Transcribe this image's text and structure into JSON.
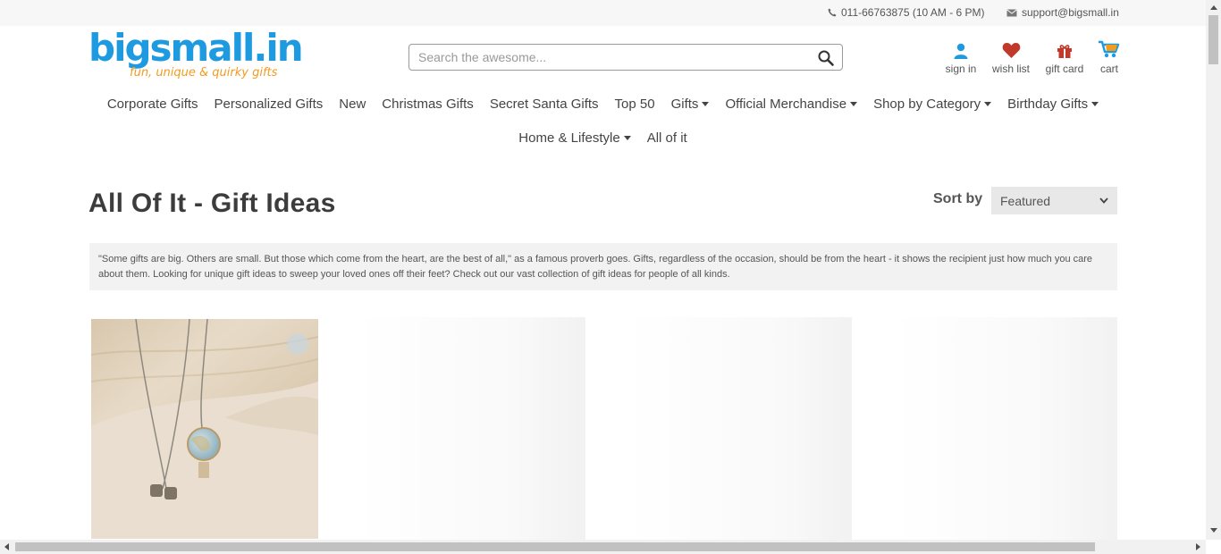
{
  "topbar": {
    "phone": "011-66763875 (10 AM - 6 PM)",
    "email": "support@bigsmall.in"
  },
  "logo": {
    "name": "bigsmall.in",
    "tagline": "fun, unique & quirky gifts"
  },
  "search": {
    "placeholder": "Search the awesome..."
  },
  "user_links": [
    {
      "label": "sign in",
      "icon": "user-icon"
    },
    {
      "label": "wish list",
      "icon": "heart-icon"
    },
    {
      "label": "gift card",
      "icon": "gift-icon"
    },
    {
      "label": "cart",
      "icon": "cart-icon"
    }
  ],
  "nav": {
    "row1": [
      {
        "label": "Corporate Gifts",
        "dropdown": false
      },
      {
        "label": "Personalized Gifts",
        "dropdown": false
      },
      {
        "label": "New",
        "dropdown": false
      },
      {
        "label": "Christmas Gifts",
        "dropdown": false
      },
      {
        "label": "Secret Santa Gifts",
        "dropdown": false
      },
      {
        "label": "Top 50",
        "dropdown": false
      },
      {
        "label": "Gifts",
        "dropdown": true
      },
      {
        "label": "Official Merchandise",
        "dropdown": true
      },
      {
        "label": "Shop by Category",
        "dropdown": true
      },
      {
        "label": "Birthday Gifts",
        "dropdown": true
      }
    ],
    "row2": [
      {
        "label": "Home & Lifestyle",
        "dropdown": true
      },
      {
        "label": "All of it",
        "dropdown": false
      }
    ]
  },
  "page": {
    "title": "All Of It - Gift Ideas",
    "sort_label": "Sort by",
    "sort_value": "Featured",
    "description": "\"Some gifts are big. Others are small. But those which come from the heart, are the best of all,\" as a famous proverb goes. Gifts, regardless of the occasion, should be from the heart - it shows the recipient just how much you care about them. Looking for unique gift ideas to sweep your loved ones off their feet? Check out our vast collection of gift ideas for people of all kinds."
  },
  "colors": {
    "brand_blue": "#1e9be0",
    "brand_orange": "#f39b1f",
    "heart": "#c0392b"
  }
}
